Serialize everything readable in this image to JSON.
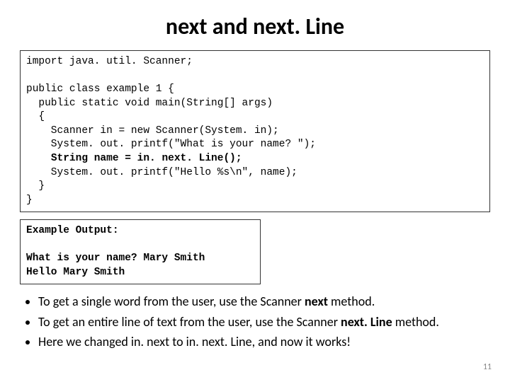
{
  "title": {
    "part1": "next",
    "sep1": " and ",
    "part2": "next. Line"
  },
  "code": {
    "l1": "import java. util. Scanner;",
    "l2": "",
    "l3": "public class example 1 {",
    "l4": "  public static void main(String[] args)",
    "l5": "  {",
    "l6": "    Scanner in = new Scanner(System. in);",
    "l7": "    System. out. printf(\"What is your name? \");",
    "l8a": "    ",
    "l8b": "String name = in. next. Line();",
    "l9": "    System. out. printf(\"Hello %s\\n\", name);",
    "l10": "  }",
    "l11": "}"
  },
  "output": {
    "heading": "Example Output:",
    "blank": "",
    "l1": "What is your name? Mary Smith",
    "l2": "Hello Mary Smith"
  },
  "bullets": {
    "b1_a": "To get a single word from the user, use the Scanner ",
    "b1_b": "next",
    "b1_c": " method.",
    "b2_a": "To get an entire line of text from the user, use the Scanner ",
    "b2_b": "next. Line",
    "b2_c": " method.",
    "b3": "Here we changed in. next to in. next. Line, and now it works!"
  },
  "page_num": "11"
}
